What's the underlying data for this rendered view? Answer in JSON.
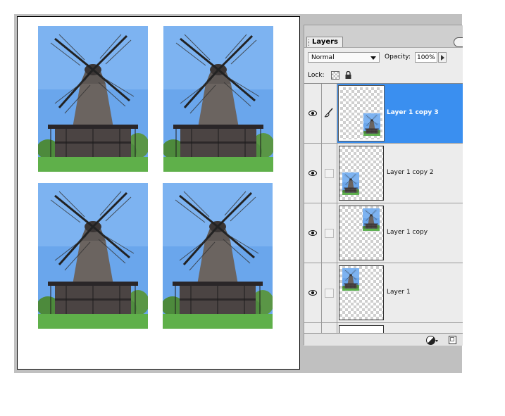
{
  "document": {
    "photos": [
      "windmill-photo",
      "windmill-photo",
      "windmill-photo",
      "windmill-photo"
    ]
  },
  "layers_panel": {
    "tab_label": "Layers",
    "blend_mode": "Normal",
    "opacity_label": "Opacity:",
    "opacity_value": "100%",
    "lock_label": "Lock:",
    "layers": [
      {
        "name": "Layer 1 copy 3",
        "selected": true,
        "visible": true
      },
      {
        "name": "Layer 1 copy 2",
        "selected": false,
        "visible": true
      },
      {
        "name": "Layer 1 copy",
        "selected": false,
        "visible": true
      },
      {
        "name": "Layer 1",
        "selected": false,
        "visible": true
      }
    ]
  },
  "colors": {
    "selection": "#3a8ff0",
    "sky": "#6fa8e8",
    "grass": "#5aa84a"
  },
  "icons": [
    "eye-icon",
    "brush-icon",
    "lock-transparency-icon",
    "lock-all-icon",
    "adjustment-layer-icon",
    "new-layer-icon",
    "palette-menu-icon"
  ]
}
